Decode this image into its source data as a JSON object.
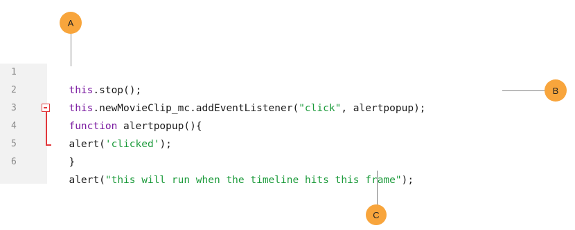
{
  "editor": {
    "lines": [
      {
        "num": "1",
        "parts": [
          {
            "kw": "this"
          },
          {
            "text": ".stop();"
          }
        ]
      },
      {
        "num": "2",
        "parts": [
          {
            "kw": "this"
          },
          {
            "text": ".newMovieClip_mc.addEventListener("
          },
          {
            "str": "\"click\""
          },
          {
            "text": ", alertpopup);"
          }
        ]
      },
      {
        "num": "3",
        "parts": [
          {
            "kw": "function"
          },
          {
            "text": " alertpopup(){"
          }
        ]
      },
      {
        "num": "4",
        "parts": [
          {
            "text": "alert("
          },
          {
            "str": "'clicked'"
          },
          {
            "text": ");"
          }
        ]
      },
      {
        "num": "5",
        "parts": [
          {
            "text": "}"
          }
        ]
      },
      {
        "num": "6",
        "parts": [
          {
            "text": "alert("
          },
          {
            "str": "\"this will run when the timeline hits this frame\""
          },
          {
            "text": ");"
          }
        ]
      }
    ]
  },
  "callouts": {
    "a": "A",
    "b": "B",
    "c": "C"
  },
  "colors": {
    "keyword": "#7a1aa0",
    "string": "#1b9a3a",
    "callout": "#f8a53c",
    "fold": "#e2373b"
  }
}
